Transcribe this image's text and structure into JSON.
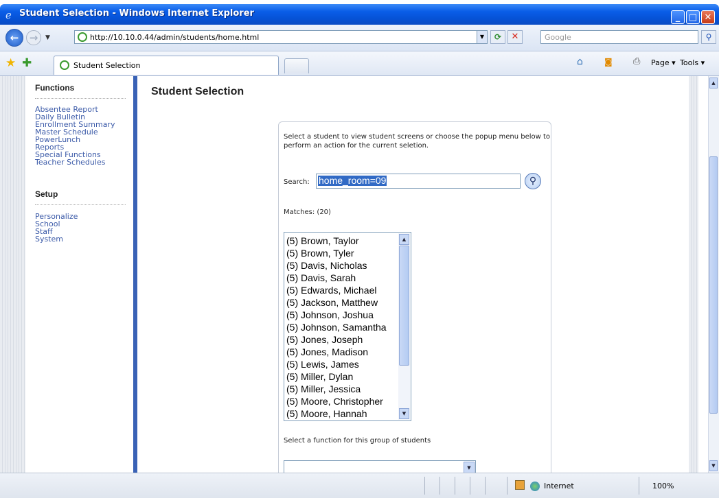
{
  "window": {
    "title": "Student Selection - Windows Internet Explorer",
    "minimize": "_",
    "maximize": "□",
    "close": "✕"
  },
  "addressbar": {
    "url": "http://10.10.0.44/admin/students/home.html",
    "search_placeholder": "Google"
  },
  "tabs": [
    {
      "label": "Student Selection"
    }
  ],
  "command_bar": {
    "page_label": "Page ▾",
    "tools_label": "Tools ▾"
  },
  "sidebar": {
    "functions_heading": "Functions",
    "functions": [
      "Absentee Report",
      "Daily Bulletin",
      "Enrollment Summary",
      "Master Schedule",
      "PowerLunch",
      "Reports",
      "Special Functions",
      "Teacher Schedules"
    ],
    "setup_heading": "Setup",
    "setup": [
      "Personalize",
      "School",
      "Staff",
      "System"
    ]
  },
  "main": {
    "title": "Student Selection",
    "instructions": "Select a student to view student screens or choose the popup menu below to perform an action for the current seletion.",
    "search_label": "Search:",
    "search_value": "home_room=09",
    "matches_label": "Matches: (20)",
    "students": [
      "(5) Brown, Taylor",
      "(5) Brown, Tyler",
      "(5) Davis, Nicholas",
      "(5) Davis, Sarah",
      "(5) Edwards, Michael",
      "(5) Jackson, Matthew",
      "(5) Johnson, Joshua",
      "(5) Johnson, Samantha",
      "(5) Jones, Joseph",
      "(5) Jones, Madison",
      "(5) Lewis, James",
      "(5) Miller, Dylan",
      "(5) Miller, Jessica",
      "(5) Moore, Christopher",
      "(5) Moore, Hannah"
    ],
    "function_label": "Select a function for this group of students",
    "function_value": ""
  },
  "statusbar": {
    "zone": "Internet",
    "zoom": "100%"
  },
  "colors": {
    "titlebar": "#0a5ee8",
    "link": "#3b5aa8",
    "selection": "#316ac5",
    "nav_separator": "#3a62b6"
  }
}
